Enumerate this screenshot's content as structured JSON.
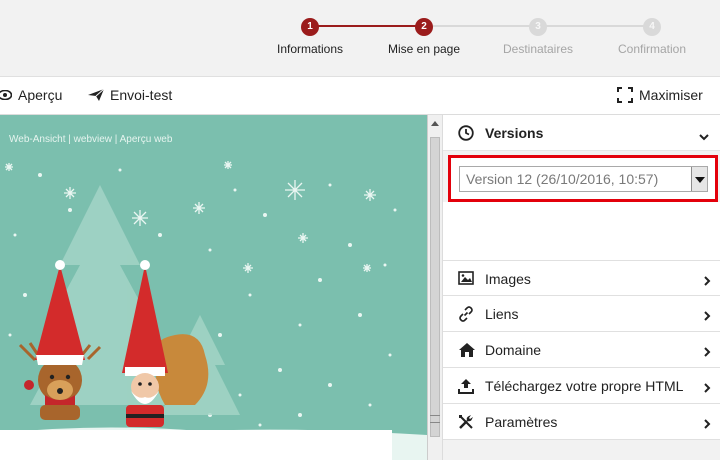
{
  "stepper": {
    "steps": [
      {
        "number": "1",
        "label": "Informations",
        "state": "done"
      },
      {
        "number": "2",
        "label": "Mise en page",
        "state": "current"
      },
      {
        "number": "3",
        "label": "Destinataires",
        "state": "todo"
      },
      {
        "number": "4",
        "label": "Confirmation",
        "state": "todo"
      }
    ]
  },
  "toolbar": {
    "preview_label": "Aperçu",
    "test_send_label": "Envoi-test",
    "maximize_label": "Maximiser"
  },
  "preview": {
    "webview_text": "Web-Ansicht | webview | Aperçu web"
  },
  "panel": {
    "versions": {
      "title": "Versions",
      "selected_version": "Version 12 (26/10/2016, 10:57)"
    },
    "items": [
      {
        "label": "Images",
        "icon": "image-icon"
      },
      {
        "label": "Liens",
        "icon": "link-icon"
      },
      {
        "label": "Domaine",
        "icon": "home-icon"
      },
      {
        "label": "Téléchargez votre propre HTML",
        "icon": "upload-icon"
      },
      {
        "label": "Paramètres",
        "icon": "tools-icon"
      }
    ]
  },
  "colors": {
    "accent": "#9b1c1c",
    "preview_background": "#7bbfae",
    "highlight": "#e3000b"
  }
}
